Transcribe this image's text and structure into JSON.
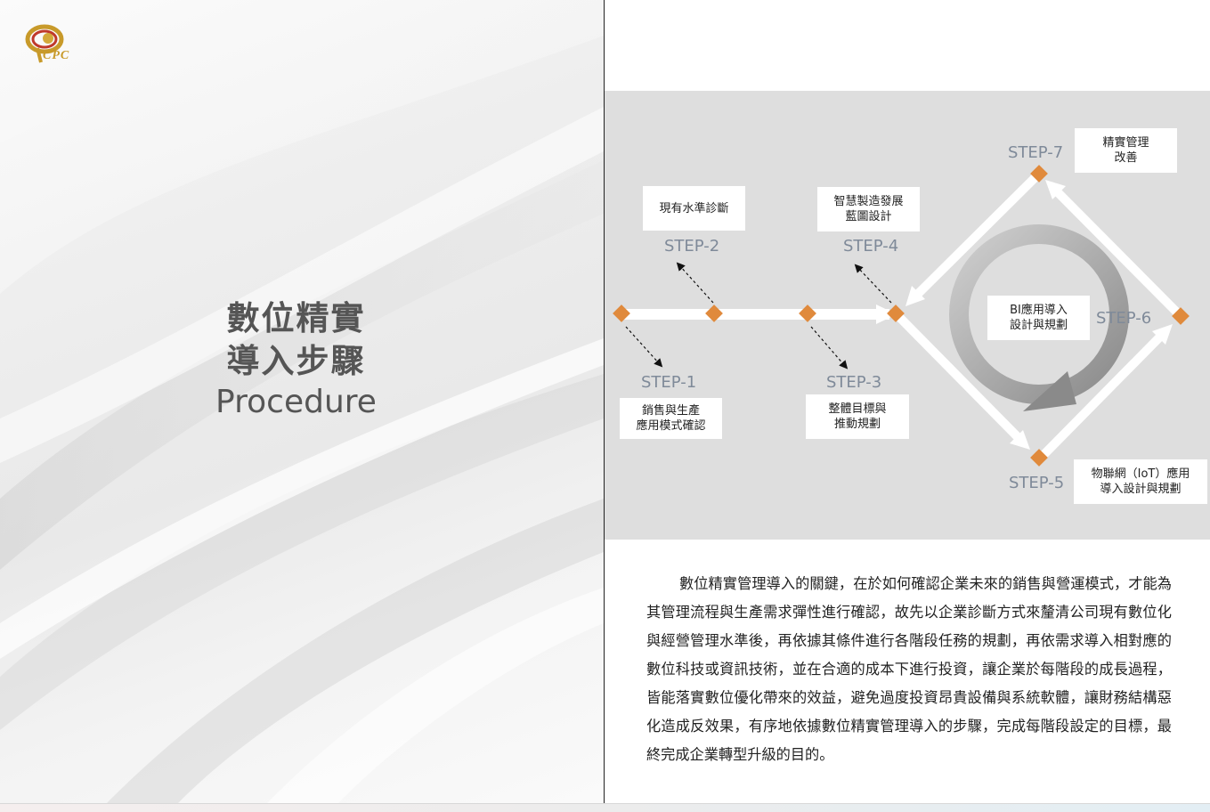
{
  "logo": {
    "text": "CPC",
    "colors": {
      "gold": "#c89a2a",
      "red": "#c0392b"
    }
  },
  "title": {
    "line1": "數位精實",
    "line2": "導入步驟",
    "line3": "Procedure"
  },
  "diagram": {
    "accent_color": "#e08a3c",
    "steps": [
      {
        "label": "STEP-1",
        "text_line1": "銷售與生產",
        "text_line2": "應用模式確認"
      },
      {
        "label": "STEP-2",
        "text_line1": "現有水準診斷",
        "text_line2": ""
      },
      {
        "label": "STEP-3",
        "text_line1": "整體目標與",
        "text_line2": "推動規劃"
      },
      {
        "label": "STEP-4",
        "text_line1": "智慧製造發展",
        "text_line2": "藍圖設計"
      },
      {
        "label": "STEP-5",
        "text_line1": "物聯網（IoT）應用",
        "text_line2": "導入設計與規劃"
      },
      {
        "label": "STEP-6",
        "text_line1": "",
        "text_line2": ""
      },
      {
        "label": "STEP-7",
        "text_line1": "精實管理",
        "text_line2": "改善"
      }
    ],
    "center": {
      "line1": "BI應用導入",
      "line2": "設計與規劃"
    }
  },
  "body": {
    "paragraph": "數位精實管理導入的關鍵，在於如何確認企業未來的銷售與營運模式，才能為其管理流程與生產需求彈性進行確認，故先以企業診斷方式來釐清公司現有數位化與經營管理水準後，再依據其條件進行各階段任務的規劃，再依需求導入相對應的數位科技或資訊技術，並在合適的成本下進行投資，讓企業於每階段的成長過程，皆能落實數位優化帶來的效益，避免過度投資昂貴設備與系統軟體，讓財務結構惡化造成反效果，有序地依據數位精實管理導入的步驟，完成每階段設定的目標，最終完成企業轉型升級的目的。"
  }
}
